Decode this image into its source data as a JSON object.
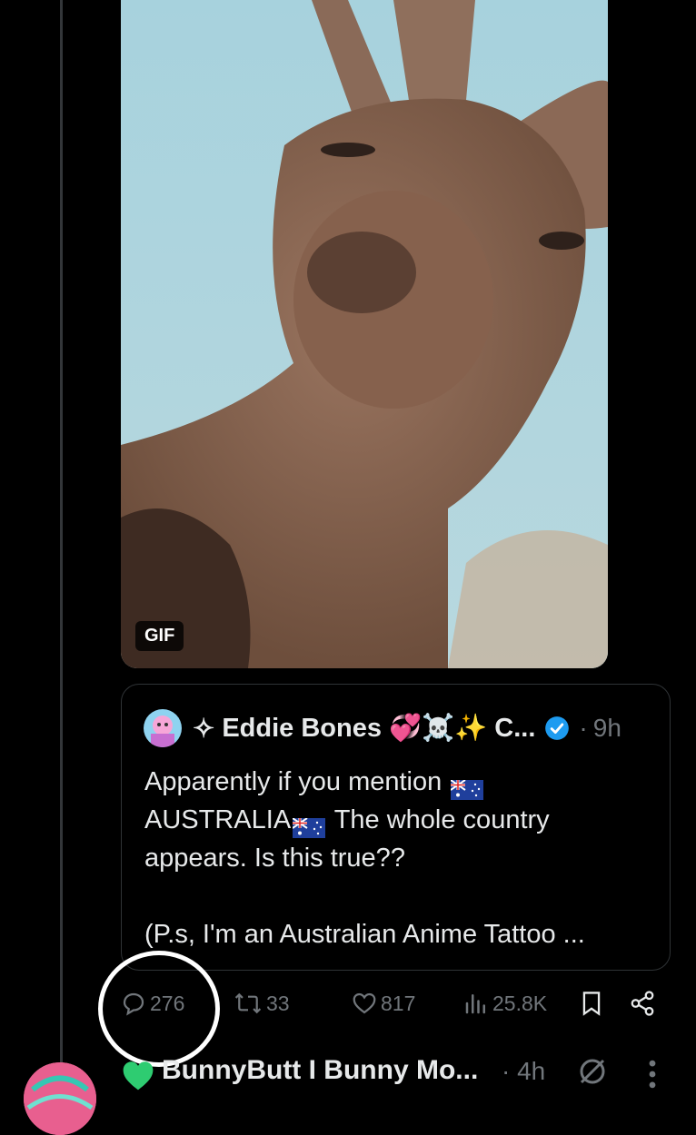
{
  "media": {
    "badge": "GIF",
    "subject": "kangaroo"
  },
  "quote": {
    "prefix": "✧",
    "author_name": "Eddie Bones",
    "author_emojis": "💞☠️✨",
    "author_suffix": "C...",
    "separator": "·",
    "time": "9h",
    "text_line1_a": "Apparently if you mention",
    "text_line2_a": "AUSTRALIA",
    "text_line2_b": " The whole country",
    "text_line3": "appears. Is this true??",
    "text_line5": "(P.s, I'm an Australian Anime Tattoo ..."
  },
  "actions": {
    "replies": "276",
    "reposts": "33",
    "likes": "817",
    "views": "25.8K"
  },
  "next_reply": {
    "name": "BunnyButt I Bunny Mo...",
    "time": "· 4h"
  },
  "colors": {
    "background": "#000000",
    "text": "#e7e9ea",
    "muted": "#71767b",
    "verified": "#1d9bf0",
    "border": "#2f3336"
  }
}
